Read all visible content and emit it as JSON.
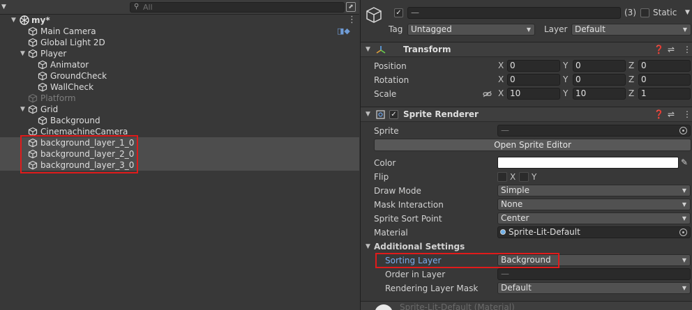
{
  "hierarchy": {
    "search_placeholder": "All",
    "scene_name": "my*",
    "rows": [
      {
        "label": "Main Camera",
        "level": 1
      },
      {
        "label": "Global Light 2D",
        "level": 1
      },
      {
        "label": "Player",
        "level": 1,
        "expanded": true
      },
      {
        "label": "Animator",
        "level": 2
      },
      {
        "label": "GroundCheck",
        "level": 2
      },
      {
        "label": "WallCheck",
        "level": 2
      },
      {
        "label": "Platform",
        "level": 1,
        "disabled": true
      },
      {
        "label": "Grid",
        "level": 1,
        "expanded": true
      },
      {
        "label": "Background",
        "level": 2
      },
      {
        "label": "CinemachineCamera",
        "level": 1
      },
      {
        "label": "background_layer_1_0",
        "level": 1,
        "selected": true
      },
      {
        "label": "background_layer_2_0",
        "level": 1,
        "selected": true
      },
      {
        "label": "background_layer_3_0",
        "level": 1,
        "selected": true
      }
    ]
  },
  "inspector": {
    "name_value": "—",
    "multi_count": "(3)",
    "static_label": "Static",
    "tag_label": "Tag",
    "tag_value": "Untagged",
    "layer_label": "Layer",
    "layer_value": "Default",
    "transform": {
      "title": "Transform",
      "position_label": "Position",
      "rotation_label": "Rotation",
      "scale_label": "Scale",
      "axis_x": "X",
      "axis_y": "Y",
      "axis_z": "Z",
      "position": [
        "0",
        "0",
        "0"
      ],
      "rotation": [
        "0",
        "0",
        "0"
      ],
      "scale": [
        "10",
        "10",
        "1"
      ]
    },
    "sprite_renderer": {
      "title": "Sprite Renderer",
      "sprite_label": "Sprite",
      "sprite_value": "—",
      "open_editor_button": "Open Sprite Editor",
      "color_label": "Color",
      "flip_label": "Flip",
      "flip_x": "X",
      "flip_y": "Y",
      "draw_mode_label": "Draw Mode",
      "draw_mode_value": "Simple",
      "mask_label": "Mask Interaction",
      "mask_value": "None",
      "sort_point_label": "Sprite Sort Point",
      "sort_point_value": "Center",
      "material_label": "Material",
      "material_value": "Sprite-Lit-Default",
      "additional_label": "Additional Settings",
      "sorting_layer_label": "Sorting Layer",
      "sorting_layer_value": "Background",
      "order_label": "Order in Layer",
      "order_value": "—",
      "rendering_mask_label": "Rendering Layer Mask",
      "rendering_mask_value": "Default"
    },
    "material_header": "Sprite-Lit-Default (Material)"
  },
  "colors": {
    "selection_highlight": "#e01b1b",
    "sorting_layer_label": "#7cadee"
  }
}
